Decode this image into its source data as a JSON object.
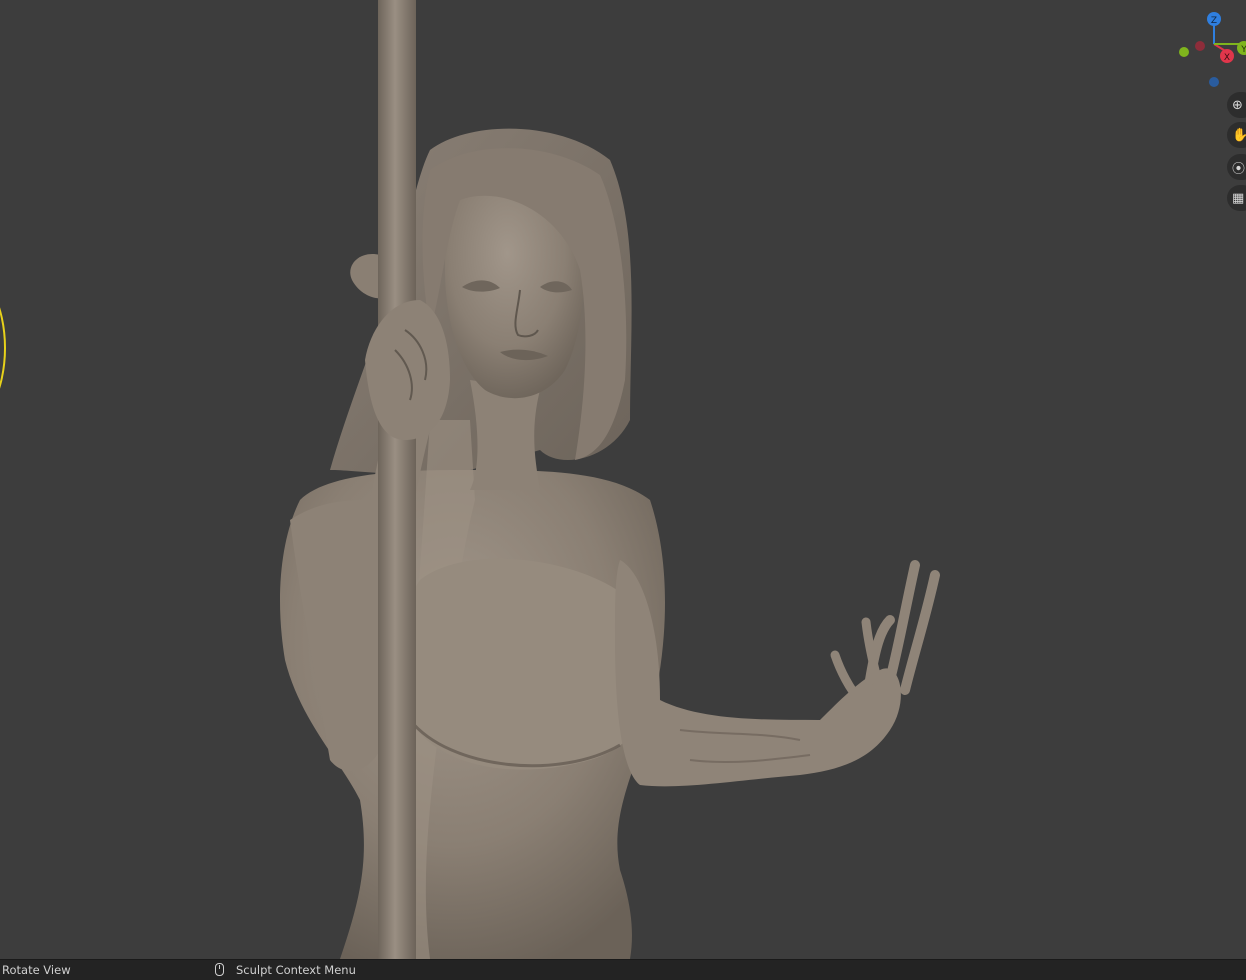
{
  "viewport": {
    "background_color": "#3d3d3d",
    "model_color": "#8b8075"
  },
  "gizmo": {
    "axes": [
      {
        "label": "Z",
        "color": "#2f7fe0"
      },
      {
        "label": "X",
        "color": "#e0364b"
      },
      {
        "label": "Y",
        "color": "#7fb51d"
      }
    ]
  },
  "nav_buttons": [
    {
      "icon": "zoom-icon",
      "glyph": "⊕"
    },
    {
      "icon": "hand-icon",
      "glyph": "✋"
    },
    {
      "icon": "camera-icon",
      "glyph": "⦿"
    },
    {
      "icon": "grid-icon",
      "glyph": "▦"
    }
  ],
  "status_bar": {
    "rotate_view": "Rotate View",
    "context_menu": "Sculpt Context Menu"
  }
}
